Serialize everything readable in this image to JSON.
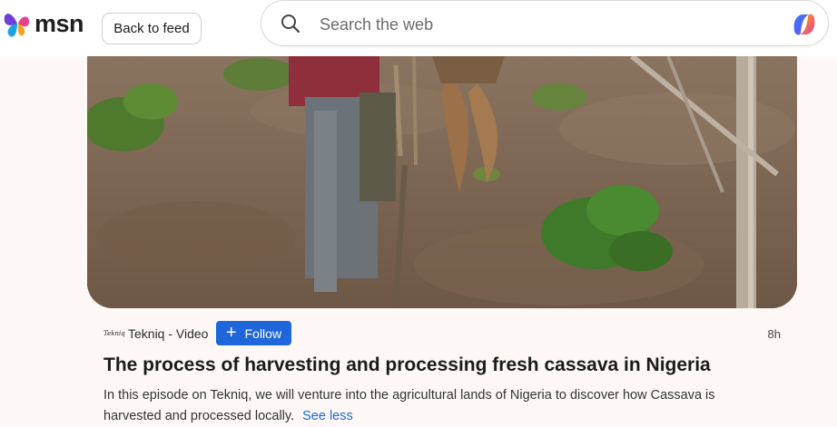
{
  "header": {
    "logo_text": "msn",
    "back_button_label": "Back to feed",
    "search": {
      "placeholder": "Search the web",
      "value": ""
    },
    "icons": [
      "msn-butterfly-logo",
      "search-icon",
      "copilot-icon"
    ]
  },
  "video": {
    "thumbnail": "video-frame-cassava-harvest"
  },
  "article": {
    "source_logo_text": "Tekniq",
    "source_label": "Tekniq - Video",
    "follow_label": "Follow",
    "follow_icon": "plus-icon",
    "time_ago": "8h",
    "title": "The process of harvesting and processing fresh cassava in Nigeria",
    "description": "In this episode on Tekniq, we will venture into the agricultural lands of Nigeria to discover how Cassava is harvested and processed locally.",
    "see_less_label": "See less"
  },
  "colors": {
    "background": "#fdf8f5",
    "accent_blue": "#1e66d9",
    "text_dark": "#1b1b1b"
  }
}
